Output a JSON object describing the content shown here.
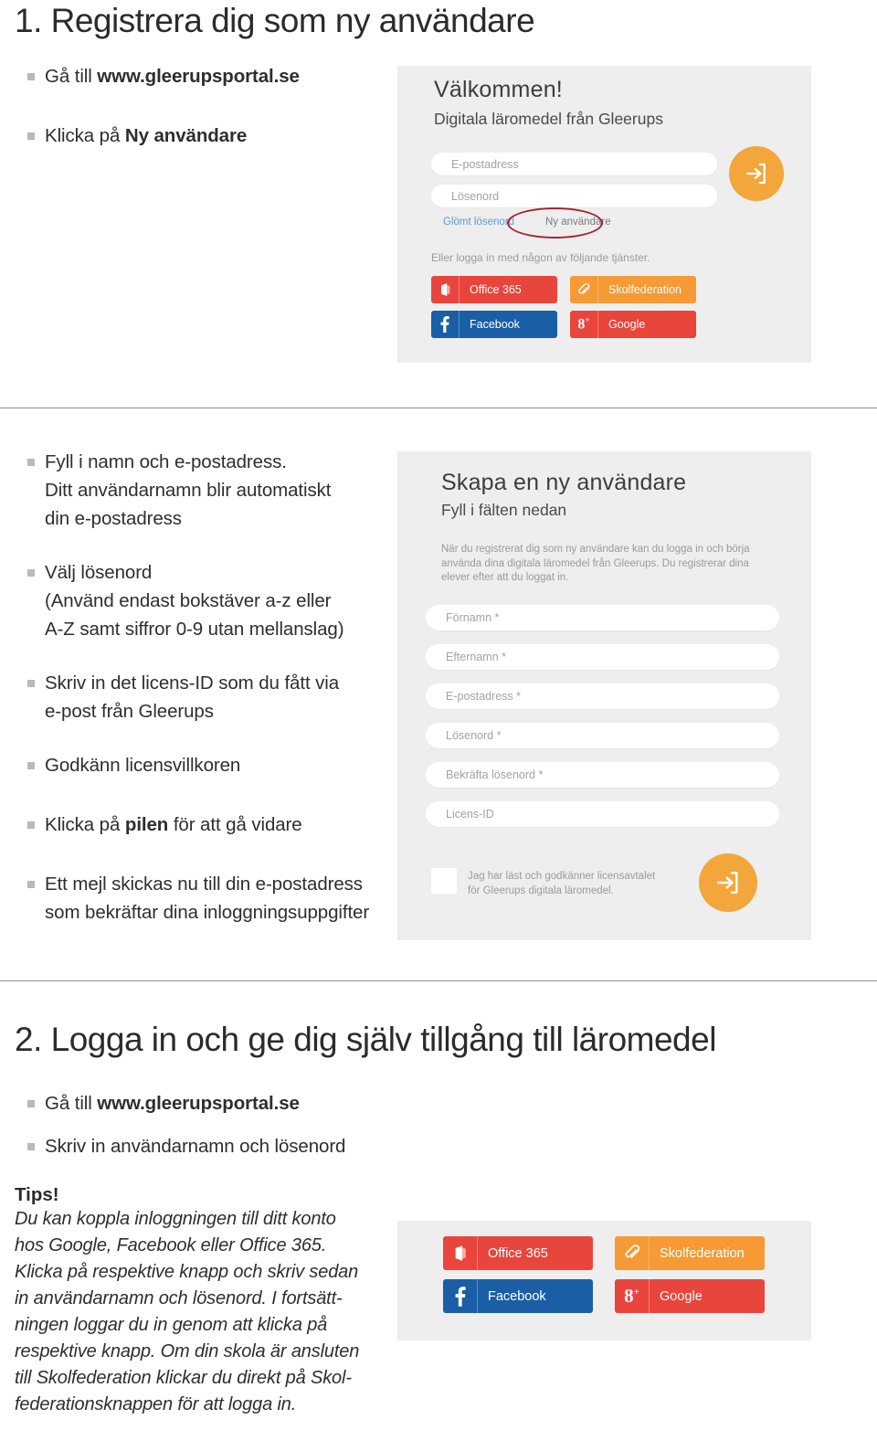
{
  "sections": [
    {
      "id": "section-1",
      "heading": "1. Registrera dig som ny användare",
      "bullets": [
        {
          "pre": "Gå till ",
          "strong": "www.gleerupsportal.se",
          "post": ""
        },
        {
          "pre": "Klicka på ",
          "strong": "Ny användare",
          "post": ""
        }
      ]
    },
    {
      "id": "section-2",
      "heading": "2. Logga in och ge dig själv tillgång till läromedel",
      "bullets": [
        {
          "pre": "Gå till ",
          "strong": "www.gleerupsportal.se",
          "post": ""
        },
        {
          "pre": "Skriv in användarnamn och lösenord",
          "strong": "",
          "post": ""
        }
      ]
    }
  ],
  "step_bullets": [
    {
      "lines": [
        "Fyll i namn och e-postadress.",
        "Ditt användarnamn blir automatiskt",
        "din e-postadress"
      ]
    },
    {
      "lines": [
        "Välj lösenord",
        "(Använd endast bokstäver a-z eller",
        "A-Z samt siffror 0-9 utan mellanslag)"
      ]
    },
    {
      "lines": [
        "Skriv in det licens-ID som du fått via",
        "e-post från Gleerups"
      ]
    },
    {
      "lines": [
        "Godkänn licensvillkoren"
      ]
    },
    {
      "lines": [
        "Klicka på ",
        "pilen",
        " för att gå vidare"
      ],
      "bold_index": 1,
      "inline": true
    },
    {
      "lines": [
        "Ett mejl skickas nu till din e-postadress",
        "som bekräftar dina inloggningsuppgifter"
      ]
    }
  ],
  "login_panel": {
    "title": "Välkommen!",
    "subtitle": "Digitala läromedel från Gleerups",
    "fields": [
      {
        "placeholder": "E-postadress"
      },
      {
        "placeholder": "Lösenord"
      }
    ],
    "links": [
      {
        "label": "Glömt lösenord",
        "style": "blue"
      },
      {
        "label": "Ny användare",
        "style": "dark"
      }
    ],
    "services_note": "Eller logga in med någon av följande tjänster.",
    "submit_icon": "login-arrow-icon"
  },
  "signup_panel": {
    "title": "Skapa en ny användare",
    "subtitle": "Fyll i fälten nedan",
    "paragraph": [
      "När du registrerat dig som ny användare kan du logga in och börja",
      "använda dina digitala läromedel från Gleerups. Du registrerar dina",
      "elever efter att du loggat in."
    ],
    "fields": [
      {
        "placeholder": "Förnamn *"
      },
      {
        "placeholder": "Efternamn *"
      },
      {
        "placeholder": "E-postadress *"
      },
      {
        "placeholder": "Lösenord *"
      },
      {
        "placeholder": "Bekräfta lösenord *"
      },
      {
        "placeholder": "Licens-ID"
      }
    ],
    "consent": [
      "Jag har läst och godkänner licensavtalet",
      "för Gleerups digitala läromedel."
    ],
    "submit_icon": "login-arrow-icon"
  },
  "social_buttons": [
    {
      "label": "Office 365",
      "icon": "office-icon",
      "bg": "#e8453c",
      "cls": "bg-office"
    },
    {
      "label": "Skolfederation",
      "icon": "paperclip-icon",
      "bg": "#f59a35",
      "cls": "bg-skol"
    },
    {
      "label": "Facebook",
      "icon": "facebook-icon",
      "bg": "#1a5fa5",
      "cls": "bg-fb"
    },
    {
      "label": "Google",
      "icon": "google-plus-icon",
      "bg": "#e8453c",
      "cls": "bg-google"
    }
  ],
  "tips": {
    "title": "Tips!",
    "lines": [
      "Du kan koppla inloggningen till ditt konto",
      "hos Google, Facebook eller Office 365.",
      "Klicka på respektive knapp och skriv sedan",
      "in användarnamn och lösenord. I fortsätt-",
      "ningen loggar du in genom att klicka på",
      "respektive knapp. Om din skola är ansluten",
      "till Skolfederation klickar du direkt på Skol-",
      "federationsknappen för att logga in."
    ]
  },
  "colors": {
    "accent_orange": "#f2a63b",
    "annotation_red": "#a52330",
    "panel_bg": "#eeeeee",
    "link_blue": "#5b9bd5"
  }
}
